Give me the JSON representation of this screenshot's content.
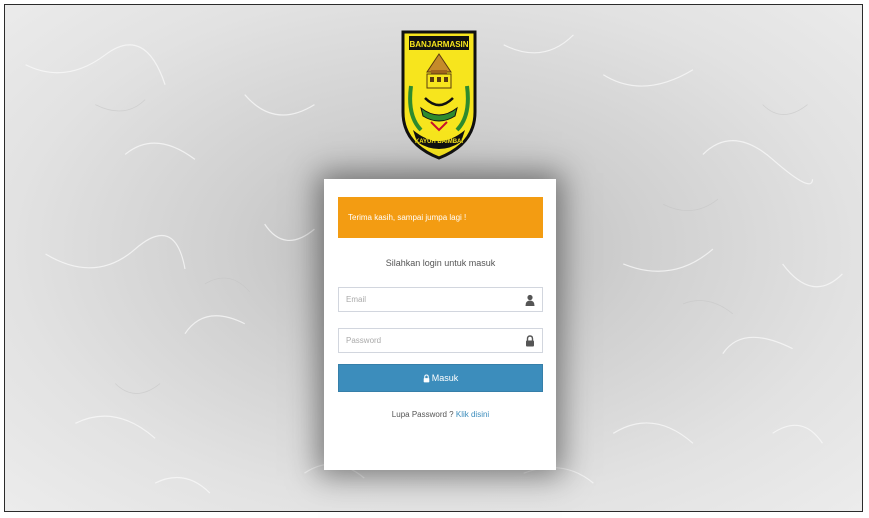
{
  "logo": {
    "top_text": "BANJARMASIN",
    "bottom_text": "KAYUH BAIMBAI",
    "colors": {
      "shield": "#f7e51d",
      "border": "#111111",
      "green": "#2e8b2e",
      "red": "#c8102e"
    }
  },
  "alert": {
    "text": "Terima kasih, sampai jumpa lagi !",
    "color": "#f39c12"
  },
  "login": {
    "intro": "Silahkan login untuk masuk",
    "email": {
      "placeholder": "Email",
      "icon": "user-icon"
    },
    "password": {
      "placeholder": "Password",
      "icon": "lock-icon"
    },
    "submit_label": "Masuk",
    "submit_icon": "lock-icon",
    "submit_color": "#3c8dbc",
    "forgot_text": "Lupa Password ?",
    "forgot_link": "Klik disini"
  }
}
